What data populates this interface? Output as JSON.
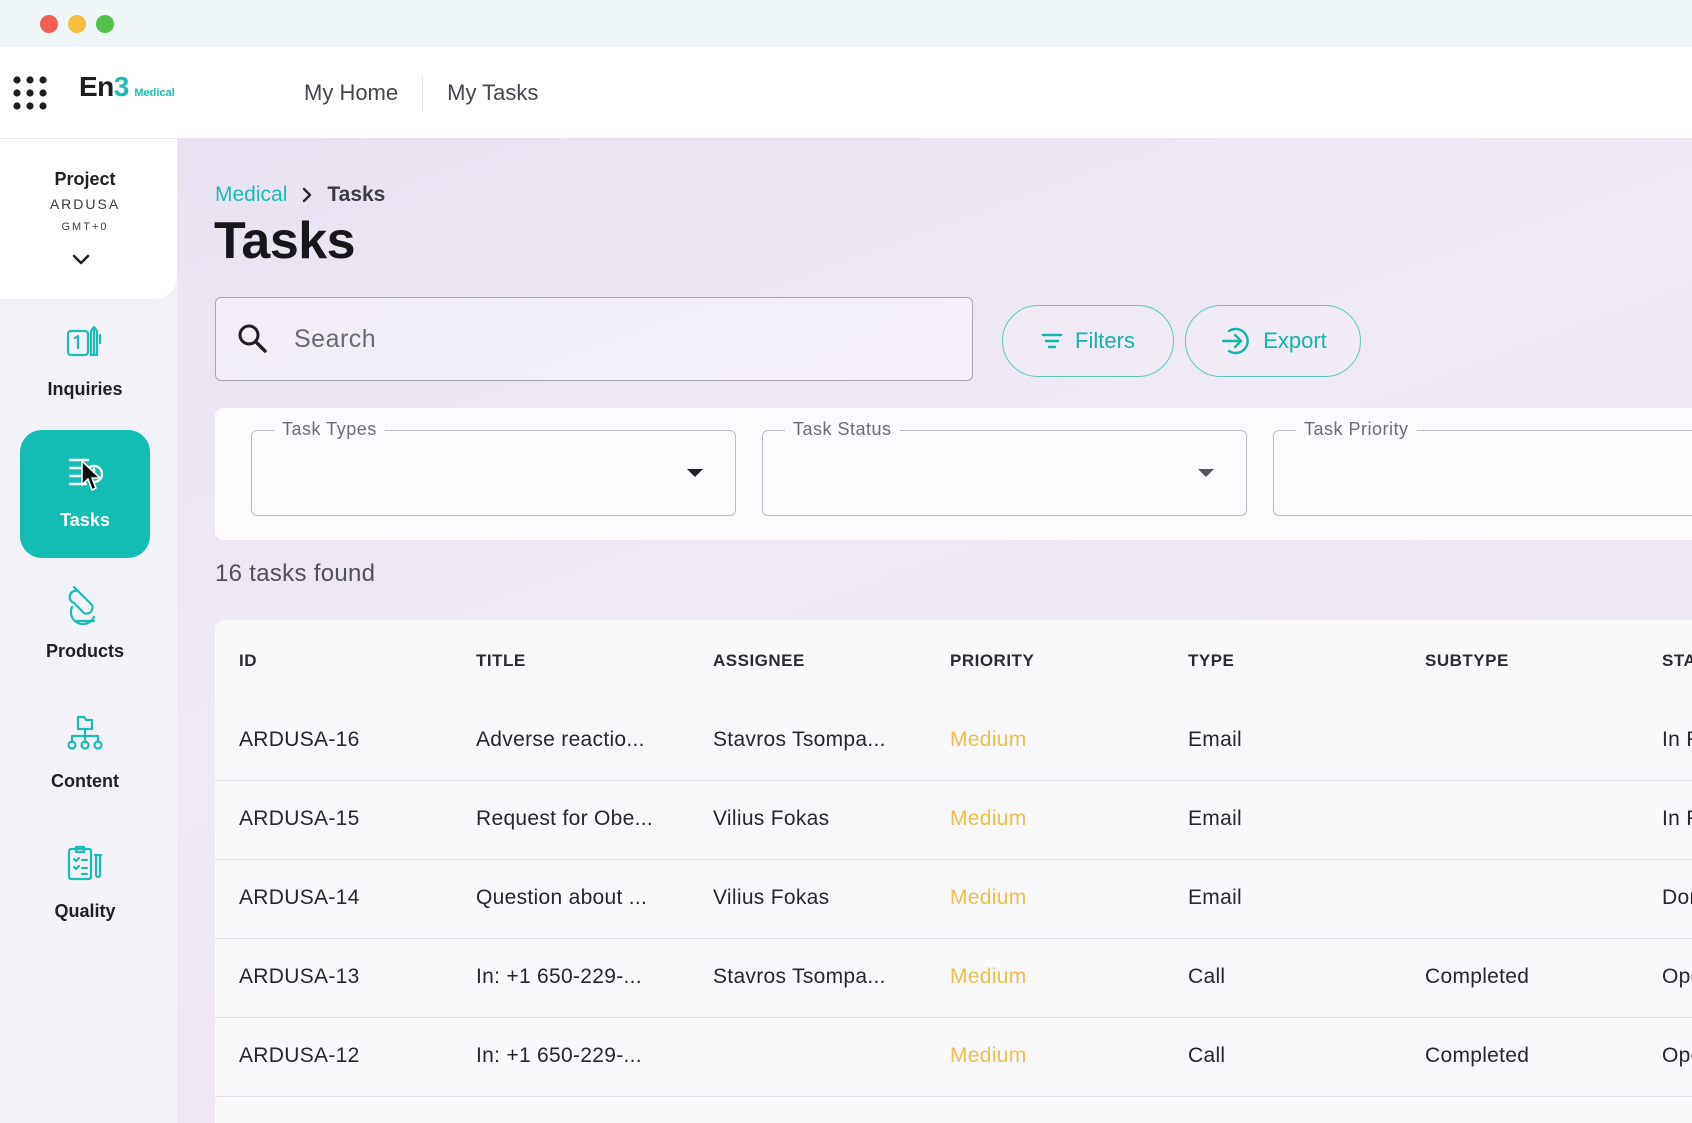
{
  "app": {
    "logo_main": "En",
    "logo_num": "3",
    "logo_sub": "Medical"
  },
  "topnav": [
    {
      "label": "My Home"
    },
    {
      "label": "My Tasks"
    }
  ],
  "project": {
    "title": "Project",
    "code": "ARDUSA",
    "timezone": "GMT+0"
  },
  "sidebar": {
    "items": [
      {
        "label": "Inquiries",
        "icon": "inquiries-icon"
      },
      {
        "label": "Tasks",
        "icon": "tasks-icon",
        "active": true
      },
      {
        "label": "Products",
        "icon": "products-icon"
      },
      {
        "label": "Content",
        "icon": "content-icon"
      },
      {
        "label": "Quality",
        "icon": "quality-icon"
      }
    ]
  },
  "breadcrumb": {
    "parent": "Medical",
    "current": "Tasks"
  },
  "page": {
    "title": "Tasks"
  },
  "search": {
    "placeholder": "Search"
  },
  "toolbar": {
    "filters_label": "Filters",
    "export_label": "Export"
  },
  "filters": {
    "task_types": {
      "label": "Task Types",
      "value": ""
    },
    "task_status": {
      "label": "Task Status",
      "value": ""
    },
    "task_priority": {
      "label": "Task Priority",
      "value": ""
    }
  },
  "results": {
    "count_text": "16 tasks found"
  },
  "table": {
    "columns": [
      "ID",
      "TITLE",
      "ASSIGNEE",
      "PRIORITY",
      "TYPE",
      "SUBTYPE",
      "STA"
    ],
    "rows": [
      {
        "id": "ARDUSA-16",
        "title": "Adverse reactio...",
        "assignee": "Stavros Tsompa...",
        "priority": "Medium",
        "type": "Email",
        "subtype": "",
        "status": "In F"
      },
      {
        "id": "ARDUSA-15",
        "title": "Request for Obe...",
        "assignee": "Vilius Fokas",
        "priority": "Medium",
        "type": "Email",
        "subtype": "",
        "status": "In F"
      },
      {
        "id": "ARDUSA-14",
        "title": "Question about ...",
        "assignee": "Vilius Fokas",
        "priority": "Medium",
        "type": "Email",
        "subtype": "",
        "status": "Dor"
      },
      {
        "id": "ARDUSA-13",
        "title": "In: +1 650-229-...",
        "assignee": "Stavros Tsompa...",
        "priority": "Medium",
        "type": "Call",
        "subtype": "Completed",
        "status": "Ope"
      },
      {
        "id": "ARDUSA-12",
        "title": "In: +1 650-229-...",
        "assignee": "",
        "priority": "Medium",
        "type": "Call",
        "subtype": "Completed",
        "status": "Ope"
      }
    ]
  },
  "colors": {
    "accent": "#1cbcb4",
    "priority_medium": "#efbe4a",
    "active_nav": "#14bdb4"
  }
}
